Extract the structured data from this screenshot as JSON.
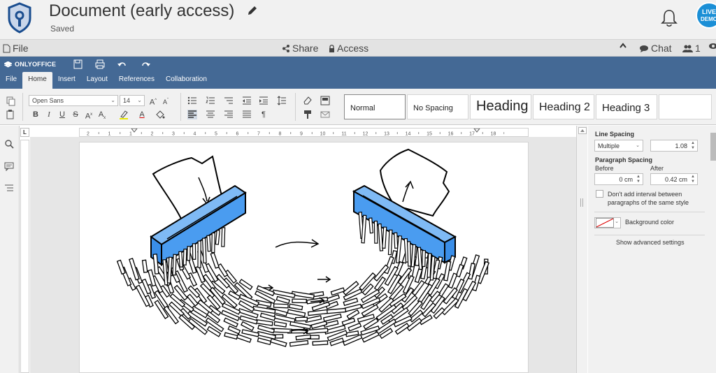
{
  "app": {
    "title": "Document (early access)",
    "status": "Saved",
    "live_demo": "LIVE DEMO"
  },
  "file_bar": {
    "file_label": "File",
    "share_label": "Share",
    "access_label": "Access",
    "chat_label": "Chat",
    "users_count": "1"
  },
  "editor": {
    "brand": "ONLYOFFICE",
    "tabs": [
      "File",
      "Home",
      "Insert",
      "Layout",
      "References",
      "Collaboration"
    ],
    "active_tab": "Home"
  },
  "toolbar": {
    "font_name": "Open Sans",
    "font_size": "14",
    "bold": "B",
    "italic": "I",
    "underline": "U",
    "strike": "S",
    "superscript": "A",
    "subscript": "A",
    "grow_font": "A",
    "shrink_font": "A",
    "paragraph_mark": "¶",
    "styles": [
      "Normal",
      "No Spacing",
      "Heading",
      "Heading 2",
      "Heading 3"
    ]
  },
  "ruler": {
    "corner": "L",
    "ticks": [
      "2",
      "1",
      "1",
      "2",
      "3",
      "4",
      "5",
      "6",
      "7",
      "8",
      "9",
      "10",
      "11",
      "12",
      "13",
      "14",
      "15",
      "16",
      "17",
      "18"
    ]
  },
  "paragraph_settings": {
    "line_spacing_label": "Line Spacing",
    "line_spacing_mode": "Multiple",
    "line_spacing_value": "1.08",
    "paragraph_spacing_label": "Paragraph Spacing",
    "before_label": "Before",
    "before_value": "0 cm",
    "after_label": "After",
    "after_value": "0.42 cm",
    "dont_add_interval": "Don't add interval between paragraphs of the same style",
    "background_color_label": "Background color",
    "advanced_link": "Show advanced settings"
  },
  "colors": {
    "header_bg": "#446995",
    "shredder_blue": "#4a9cf0",
    "panel_bg": "#f1f1f1"
  }
}
